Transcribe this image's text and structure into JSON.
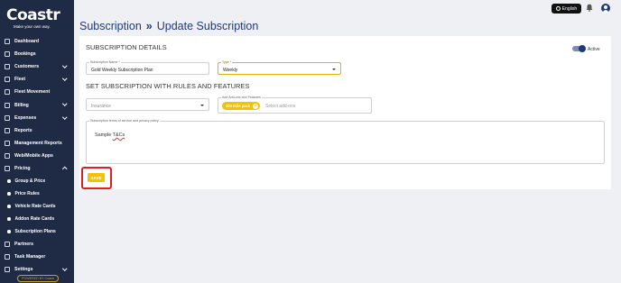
{
  "brand": {
    "name": "Coastr",
    "tagline": "Make your own way."
  },
  "sidebar": {
    "items": [
      {
        "label": "Dashboard"
      },
      {
        "label": "Bookings"
      },
      {
        "label": "Customers",
        "expandable": true
      },
      {
        "label": "Fleet",
        "expandable": true
      },
      {
        "label": "Fleet Movement"
      },
      {
        "label": "Billing",
        "expandable": true
      },
      {
        "label": "Expenses",
        "expandable": true
      },
      {
        "label": "Reports"
      },
      {
        "label": "Management Reports"
      },
      {
        "label": "Web/Mobile Apps"
      },
      {
        "label": "Pricing",
        "expandable": true,
        "expanded": true
      }
    ],
    "pricing_children": [
      {
        "label": "Group & Price"
      },
      {
        "label": "Price Rules"
      },
      {
        "label": "Vehicle Rate Cards"
      },
      {
        "label": "Addon Rate Cards"
      },
      {
        "label": "Subscription Plans"
      }
    ],
    "bottom_items": [
      {
        "label": "Partners"
      },
      {
        "label": "Task Manager"
      },
      {
        "label": "Settings",
        "expandable": true
      }
    ],
    "powered_by": "POWERED BY Coastr"
  },
  "topbar": {
    "language": "English"
  },
  "page": {
    "breadcrumb_parent": "Subscription",
    "breadcrumb_sep": "»",
    "breadcrumb_current": "Update Subscription"
  },
  "form": {
    "details_title": "SUBSCRIPTION DETAILS",
    "active_label": "Active",
    "active_on": true,
    "name_label": "Subscription Name *",
    "name_value": "Gold Weekly Subscription Plan",
    "type_label": "Type *",
    "type_value": "Weekly",
    "rules_title": "SET SUBSCRIPTION WITH RULES AND FEATURES",
    "insurance_placeholder": "Insurance",
    "addons_label": "Add Add-ons and Features",
    "addon_chip": "200 mile pack",
    "addons_placeholder": "Select add-ons",
    "terms_label": "Subscription terms of service and privacy policy",
    "terms_value_prefix": "Sample ",
    "terms_value_word": "T&Cs",
    "save_label": "SAVE"
  },
  "colors": {
    "sidebar_bg": "#1f2a44",
    "accent_yellow": "#f4c300",
    "title_blue": "#1f3a7a",
    "highlight_red": "#e02020"
  }
}
